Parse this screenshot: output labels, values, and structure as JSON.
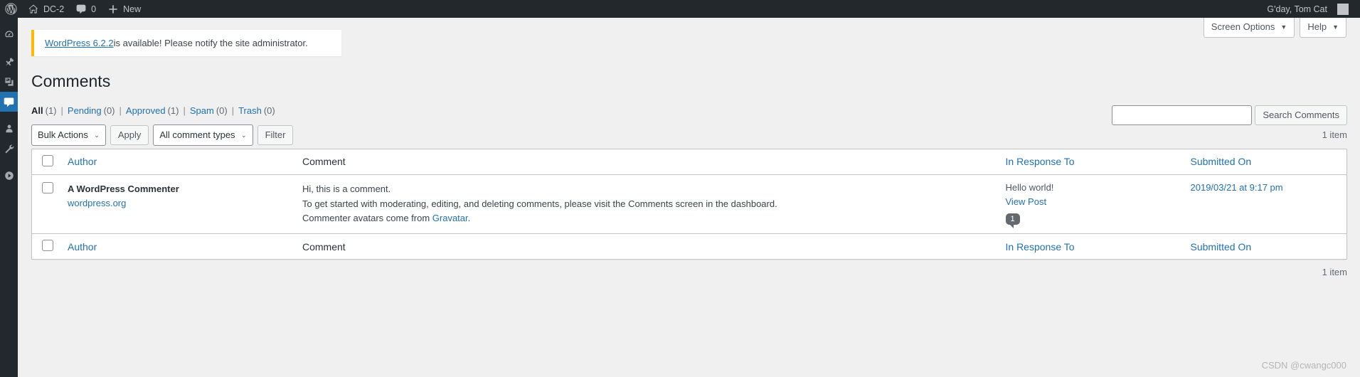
{
  "adminbar": {
    "logo_icon": "wordpress-logo-icon",
    "site_icon": "home-icon",
    "site_name": "DC-2",
    "comments_icon": "comment-bubble-icon",
    "comments_count": "0",
    "new_icon": "plus-icon",
    "new_label": "New",
    "greeting": "G'day, Tom Cat",
    "avatar": "avatar"
  },
  "sidebar": {
    "items": [
      {
        "name": "dashboard",
        "icon": "dashboard-gauge-icon",
        "current": false
      },
      {
        "name": "posts",
        "icon": "pin-icon",
        "current": false
      },
      {
        "name": "media",
        "icon": "media-images-icon",
        "current": false
      },
      {
        "name": "comments",
        "icon": "comment-bubble-icon",
        "current": true
      },
      {
        "name": "users",
        "icon": "user-icon",
        "current": false
      },
      {
        "name": "tools",
        "icon": "wrench-icon",
        "current": false
      },
      {
        "name": "collapse",
        "icon": "collapse-arrow-icon",
        "current": false
      }
    ]
  },
  "screen_meta": {
    "screen_options": "Screen Options",
    "help": "Help",
    "caret": "▼"
  },
  "notice": {
    "link_text": "WordPress 6.2.2",
    "rest_text": " is available! Please notify the site administrator."
  },
  "page": {
    "title": "Comments"
  },
  "filters": [
    {
      "label": "All",
      "count": "(1)",
      "current": true
    },
    {
      "label": "Pending",
      "count": "(0)",
      "current": false
    },
    {
      "label": "Approved",
      "count": "(1)",
      "current": false
    },
    {
      "label": "Spam",
      "count": "(0)",
      "current": false
    },
    {
      "label": "Trash",
      "count": "(0)",
      "current": false
    }
  ],
  "filter_divider": "|",
  "search": {
    "value": "",
    "placeholder": "",
    "button_label": "Search Comments"
  },
  "tablenav": {
    "bulk_actions": "Bulk Actions",
    "apply_label": "Apply",
    "comment_types": "All comment types",
    "filter_label": "Filter",
    "chevron": "⌄",
    "item_count_top": "1 item",
    "item_count_bottom": "1 item"
  },
  "table": {
    "columns": {
      "author": "Author",
      "comment": "Comment",
      "response": "In Response To",
      "date": "Submitted On"
    },
    "rows": [
      {
        "author_name": "A WordPress Commenter",
        "author_site": "wordpress.org",
        "comment_line1": "Hi, this is a comment.",
        "comment_line2": "To get started with moderating, editing, and deleting comments, please visit the Comments screen in the dashboard.",
        "comment_line3_pre": "Commenter avatars come from ",
        "comment_line3_link": "Gravatar",
        "comment_line3_post": ".",
        "response_title": "Hello world!",
        "response_link": "View Post",
        "response_count": "1",
        "date": "2019/03/21 at 9:17 pm"
      }
    ]
  },
  "watermark": "CSDN @cwangc000"
}
